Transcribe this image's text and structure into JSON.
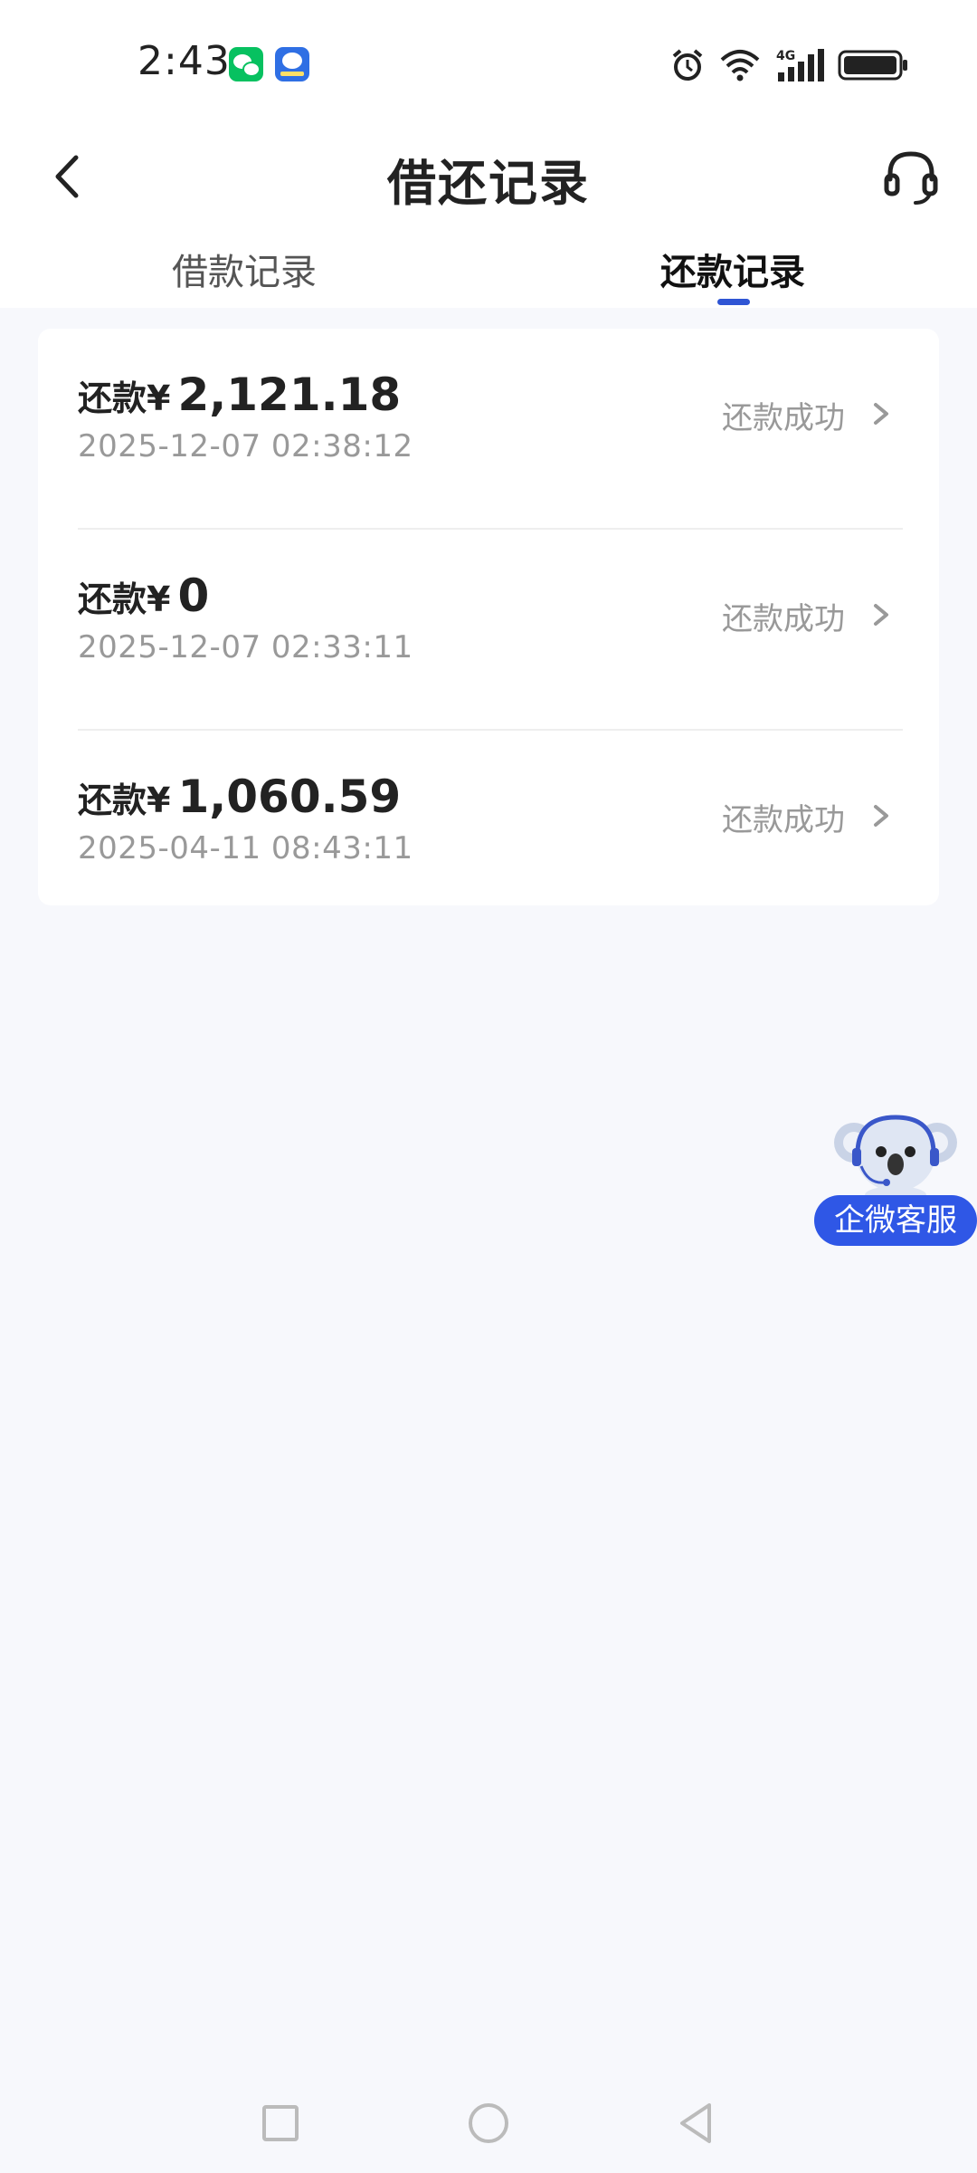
{
  "status_bar": {
    "time": "2:43",
    "app_icons": [
      "wechat-icon",
      "koala-app-icon"
    ],
    "system_icons": [
      "alarm-icon",
      "wifi-icon",
      "signal-4g-icon",
      "battery-icon"
    ],
    "network_label": "4G"
  },
  "header": {
    "title": "借还记录",
    "back_icon": "chevron-left-icon",
    "support_icon": "headset-icon"
  },
  "tabs": [
    {
      "label": "借款记录",
      "active": false
    },
    {
      "label": "还款记录",
      "active": true
    }
  ],
  "records": [
    {
      "prefix": "还款¥",
      "amount": "2,121.18",
      "time": "2025-12-07 02:38:12",
      "status": "还款成功"
    },
    {
      "prefix": "还款¥",
      "amount": "0",
      "time": "2025-12-07 02:33:11",
      "status": "还款成功"
    },
    {
      "prefix": "还款¥",
      "amount": "1,060.59",
      "time": "2025-04-11 08:43:11",
      "status": "还款成功"
    }
  ],
  "service_float": {
    "label": "企微客服",
    "icon": "koala-mascot-icon"
  },
  "colors": {
    "accent": "#2f55d4",
    "background": "#f7f8fc",
    "card": "#ffffff",
    "muted_text": "#999999"
  },
  "nav_bar": [
    "recent-apps-icon",
    "home-icon",
    "back-triangle-icon"
  ]
}
